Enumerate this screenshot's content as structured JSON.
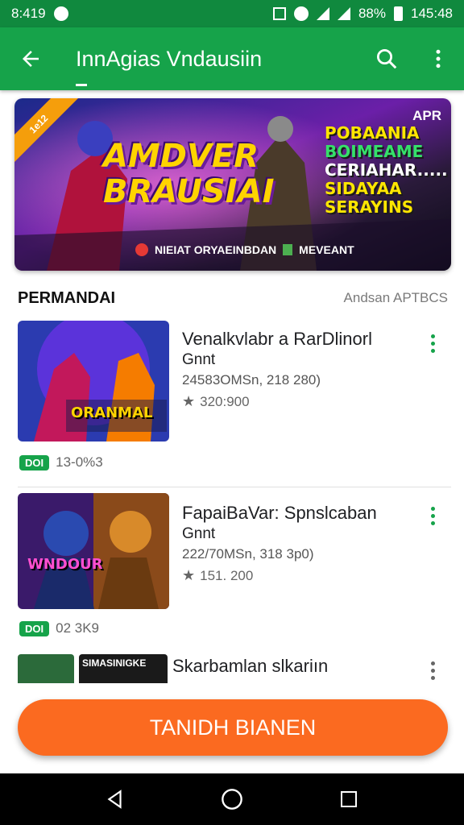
{
  "status_bar": {
    "time_left": "8:419",
    "battery": "88%",
    "time_right": "145:48"
  },
  "app_bar": {
    "title": "InnAgias Vndausiin"
  },
  "banner": {
    "ribbon": "1e12",
    "title_line1": "AMDVER",
    "title_line2": "BRAUSIAI",
    "badge": "APR",
    "promo_line1": "POBAANIA",
    "promo_line2": "BOIMEAME",
    "promo_line3": "CERIAHAR.....",
    "promo_line4": "SIDAYAA",
    "promo_line5": "SERAYINS",
    "footer_text": "NIEIAT ORYAEINBDAN",
    "footer_sub": "MEVEANT"
  },
  "section": {
    "title": "PERMANDAI",
    "link": "Andsan APTBCS"
  },
  "games": [
    {
      "title": "Venalkvlabr a RarDlinorl",
      "subtitle": "Gnnt",
      "meta": "24583OMSn, 218 280)",
      "rating": "320:900",
      "tag": "DOI",
      "tag_text": "13-0%3",
      "thumb_text": "ORANMAL"
    },
    {
      "title": "FapaiBaVar: Spnslcaban",
      "subtitle": "Gnnt",
      "meta": "222/70MSn, 318 3p0)",
      "rating": "151. 200",
      "tag": "DOI",
      "tag_text": "02 3K9",
      "thumb_text": "WNDOUR"
    },
    {
      "title": "Skarbamlan slkariın",
      "thumb_text": "SIMASINIGKE"
    }
  ],
  "cta": {
    "label": "TANIDH BIANEN"
  },
  "colors": {
    "green": "#16a34a",
    "dark_green": "#10893e",
    "orange": "#fb6a20"
  }
}
